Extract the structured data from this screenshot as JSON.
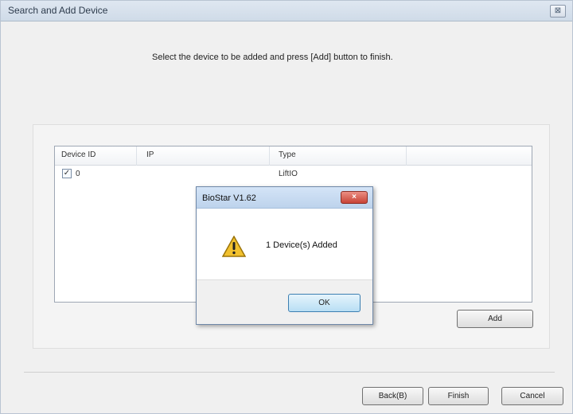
{
  "window": {
    "title": "Search and Add Device",
    "close_glyph": "⊠"
  },
  "instruction": "Select the device to be added and press [Add] button to finish.",
  "table": {
    "columns": [
      "Device ID",
      "IP",
      "Type"
    ],
    "rows": [
      {
        "checked": true,
        "check_mark": "✓",
        "device_id": "0",
        "ip": "",
        "type": "LiftIO"
      }
    ]
  },
  "buttons": {
    "add": "Add",
    "back": "Back(B)",
    "finish": "Finish",
    "cancel": "Cancel"
  },
  "message_box": {
    "title": "BioStar V1.62",
    "message": "1 Device(s) Added",
    "ok": "OK",
    "close_glyph": "×",
    "icon": "warning-icon"
  }
}
